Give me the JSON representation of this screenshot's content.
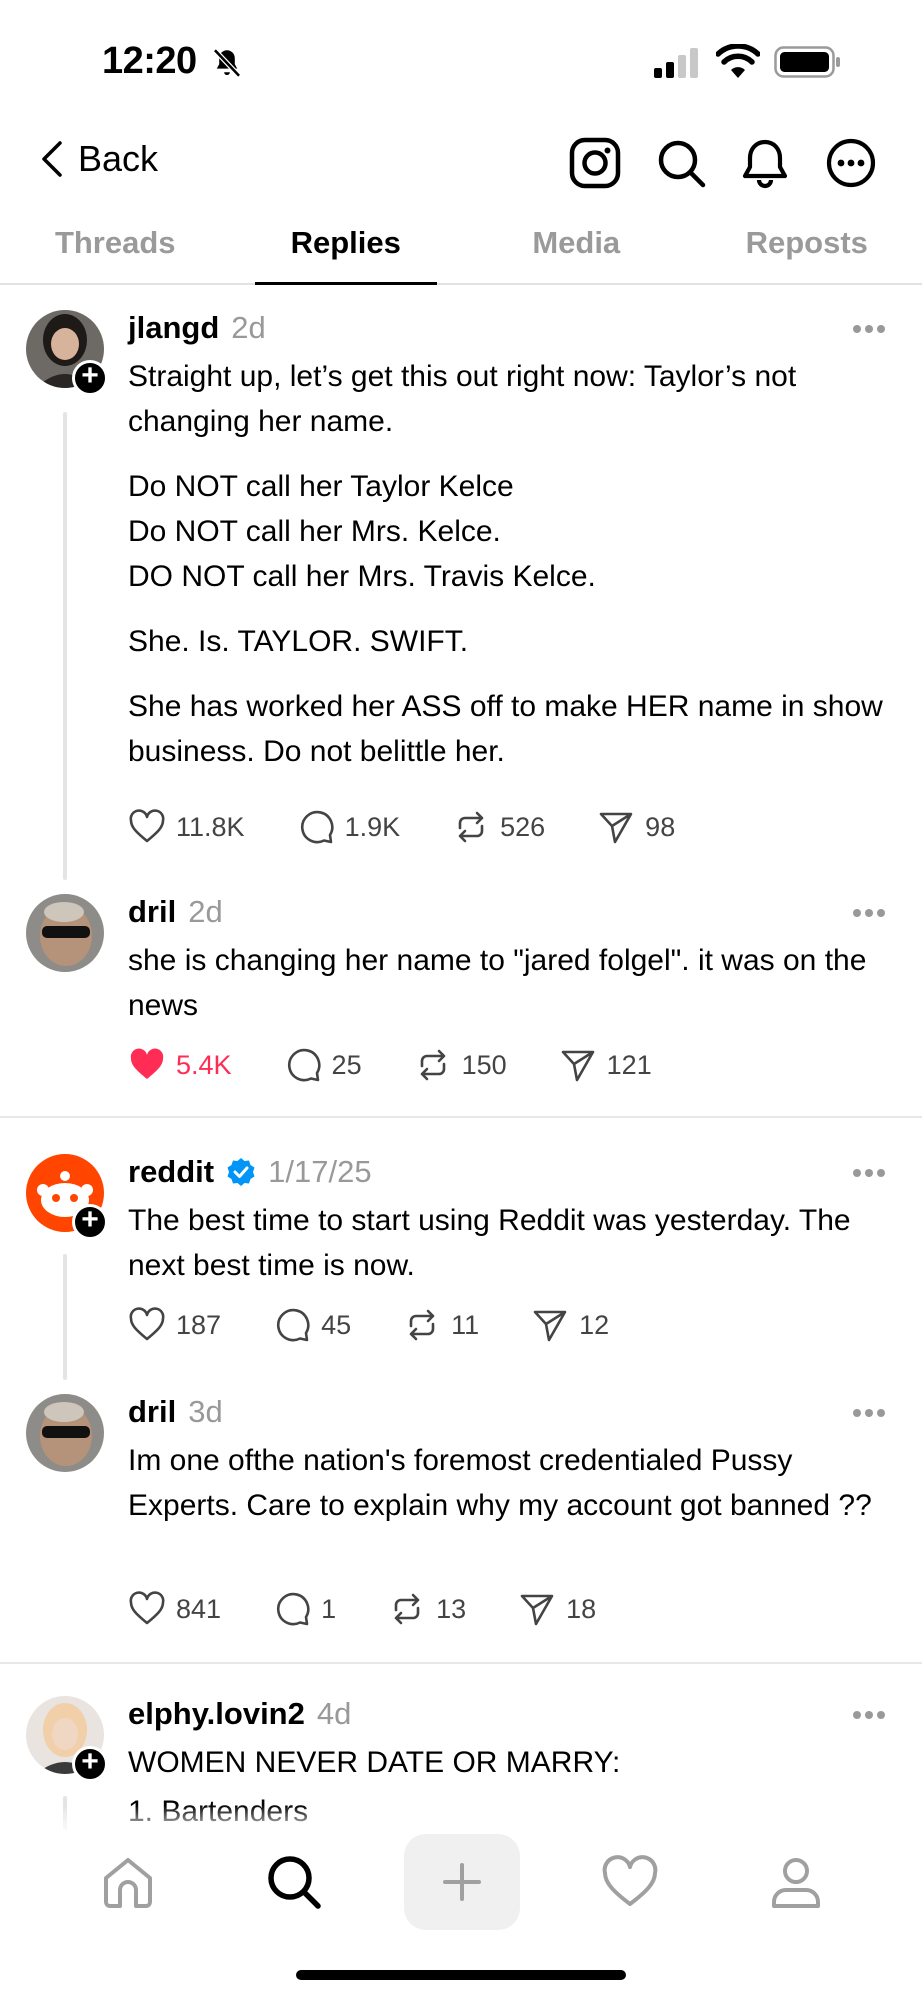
{
  "status_bar": {
    "time": "12:20"
  },
  "nav": {
    "back_label": "Back"
  },
  "tabs": [
    {
      "label": "Threads",
      "active": false
    },
    {
      "label": "Replies",
      "active": true
    },
    {
      "label": "Media",
      "active": false
    },
    {
      "label": "Reposts",
      "active": false
    }
  ],
  "posts": [
    {
      "username": "jlangd",
      "time": "2d",
      "paragraphs": [
        "Straight up, let’s get this out right now: Taylor’s not changing her name.",
        "Do NOT call her Taylor Kelce\nDo NOT call her Mrs. Kelce.\nDO NOT call her Mrs. Travis Kelce.",
        "She. Is. TAYLOR. SWIFT.",
        "She has worked her ASS off to make HER name in show business. Do not belittle her."
      ],
      "likes": "11.8K",
      "replies": "1.9K",
      "reposts": "526",
      "shares": "98"
    },
    {
      "username": "dril",
      "time": "2d",
      "paragraphs": [
        "she is changing her name to \"jared folgel\". it was on the news"
      ],
      "likes": "5.4K",
      "replies": "25",
      "reposts": "150",
      "shares": "121",
      "liked": true
    },
    {
      "username": "reddit",
      "time": "1/17/25",
      "verified": true,
      "paragraphs": [
        "The best time to start using Reddit was yesterday. The next best time is now."
      ],
      "likes": "187",
      "replies": "45",
      "reposts": "11",
      "shares": "12"
    },
    {
      "username": "dril",
      "time": "3d",
      "paragraphs": [
        "Im one ofthe nation's foremost credentialed Pussy Experts. Care to explain why my account got banned ??"
      ],
      "likes": "841",
      "replies": "1",
      "reposts": "13",
      "shares": "18"
    },
    {
      "username": "elphy.lovin2",
      "time": "4d",
      "paragraphs": [
        "WOMEN NEVER DATE OR MARRY:",
        "1. Bartenders"
      ]
    }
  ],
  "icons": {
    "nav": [
      "instagram-icon",
      "search-icon",
      "bell-icon",
      "more-icon"
    ],
    "bottom": [
      "home-icon",
      "search-icon",
      "create-icon",
      "activity-heart-icon",
      "profile-icon"
    ]
  },
  "colors": {
    "like_active": "#ff2d55",
    "verified": "#0095f6",
    "muted": "#999999"
  }
}
